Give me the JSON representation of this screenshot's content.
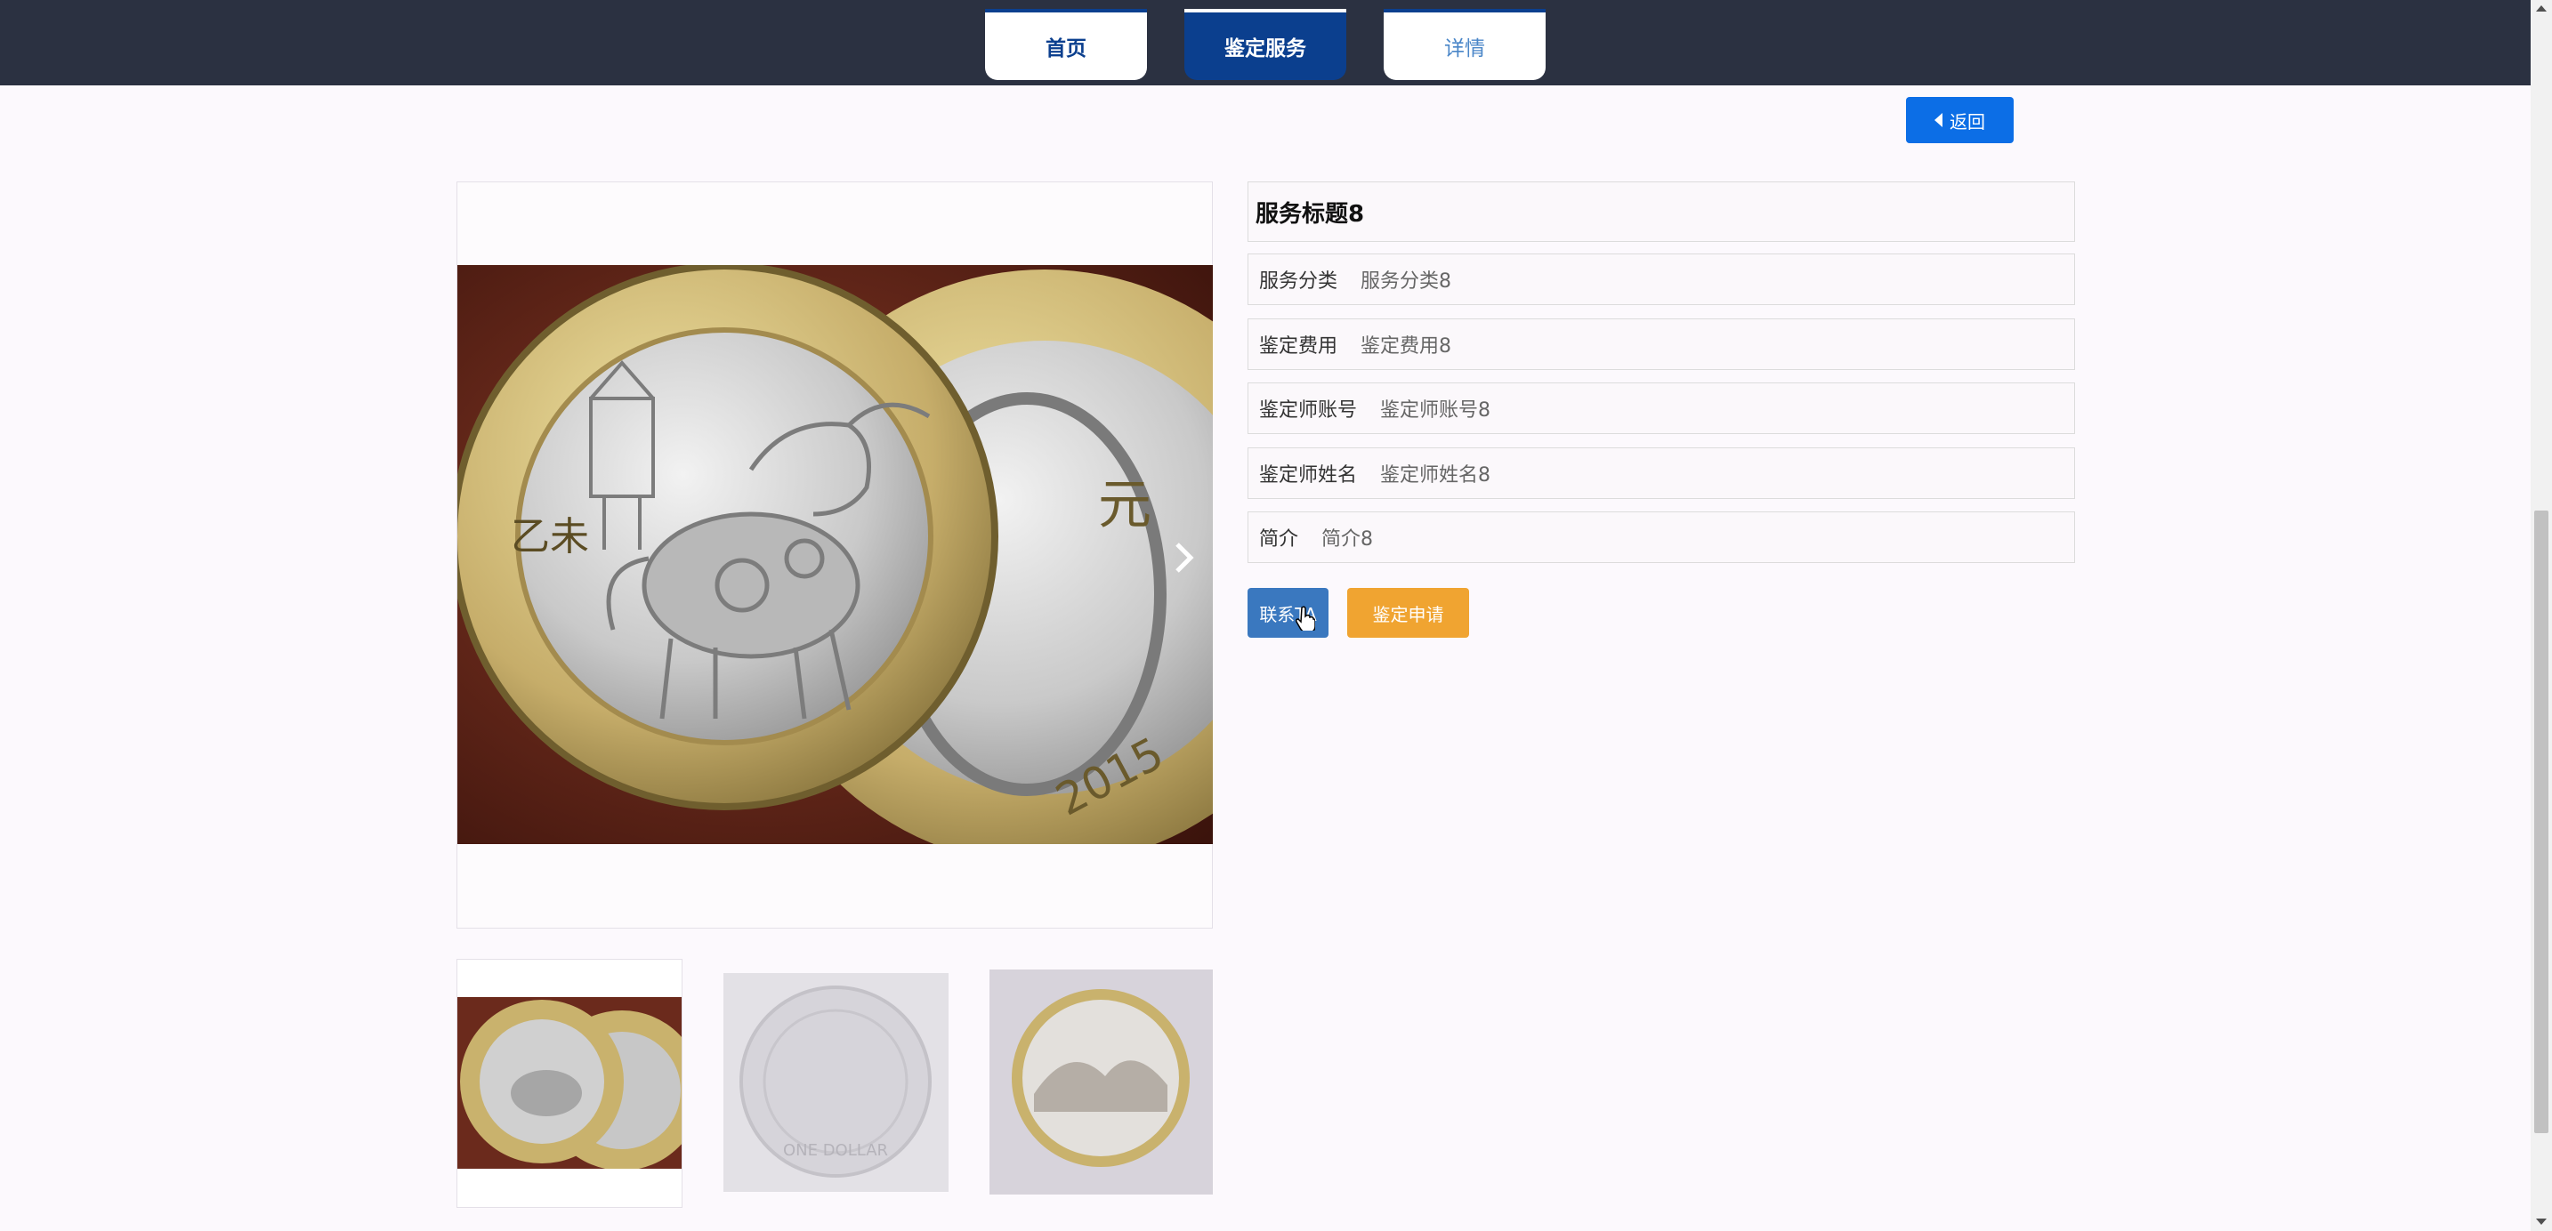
{
  "nav": {
    "tabs": [
      {
        "label": "首页"
      },
      {
        "label": "鉴定服务"
      },
      {
        "label": "详情"
      }
    ]
  },
  "back_button": {
    "label": "返回"
  },
  "detail": {
    "title": "服务标题8",
    "fields": [
      {
        "label": "服务分类",
        "value": "服务分类8"
      },
      {
        "label": "鉴定费用",
        "value": "鉴定费用8"
      },
      {
        "label": "鉴定师账号",
        "value": "鉴定师账号8"
      },
      {
        "label": "鉴定师姓名",
        "value": "鉴定师姓名8"
      },
      {
        "label": "简介",
        "value": "简介8"
      }
    ]
  },
  "actions": {
    "contact_label": "联系TA",
    "apply_label": "鉴定申请"
  },
  "coins": {
    "main_left_text": "乙未",
    "main_right_text": "元",
    "year": "2015",
    "thumb2_text": "ONE DOLLAR"
  },
  "colors": {
    "nav_bg": "#2b3141",
    "tab_active": "#0b3f8e",
    "primary": "#0c6ee6",
    "contact": "#3a78bf",
    "apply": "#f0a431"
  }
}
